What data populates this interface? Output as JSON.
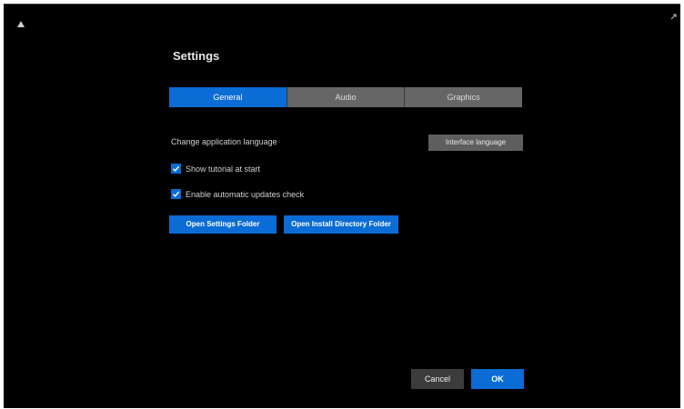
{
  "header": {
    "app_icon": "app-logo-icon",
    "corner_icon": "resize-icon"
  },
  "settings": {
    "title": "Settings"
  },
  "tabs": [
    {
      "label": "General",
      "active": true
    },
    {
      "label": "Audio",
      "active": false
    },
    {
      "label": "Graphics",
      "active": false
    }
  ],
  "language": {
    "label": "Change application language",
    "button_label": "Interface language"
  },
  "checkboxes": [
    {
      "label": "Show tutorial at start",
      "checked": true
    },
    {
      "label": "Enable automatic updates check",
      "checked": true
    }
  ],
  "actions": {
    "button1_label": "Open Settings Folder",
    "button2_label": "Open Install Directory Folder"
  },
  "footer": {
    "cancel_label": "Cancel",
    "ok_label": "OK"
  },
  "colors": {
    "accent": "#0a6cd4",
    "background": "#000000",
    "tab_inactive": "#666666"
  }
}
